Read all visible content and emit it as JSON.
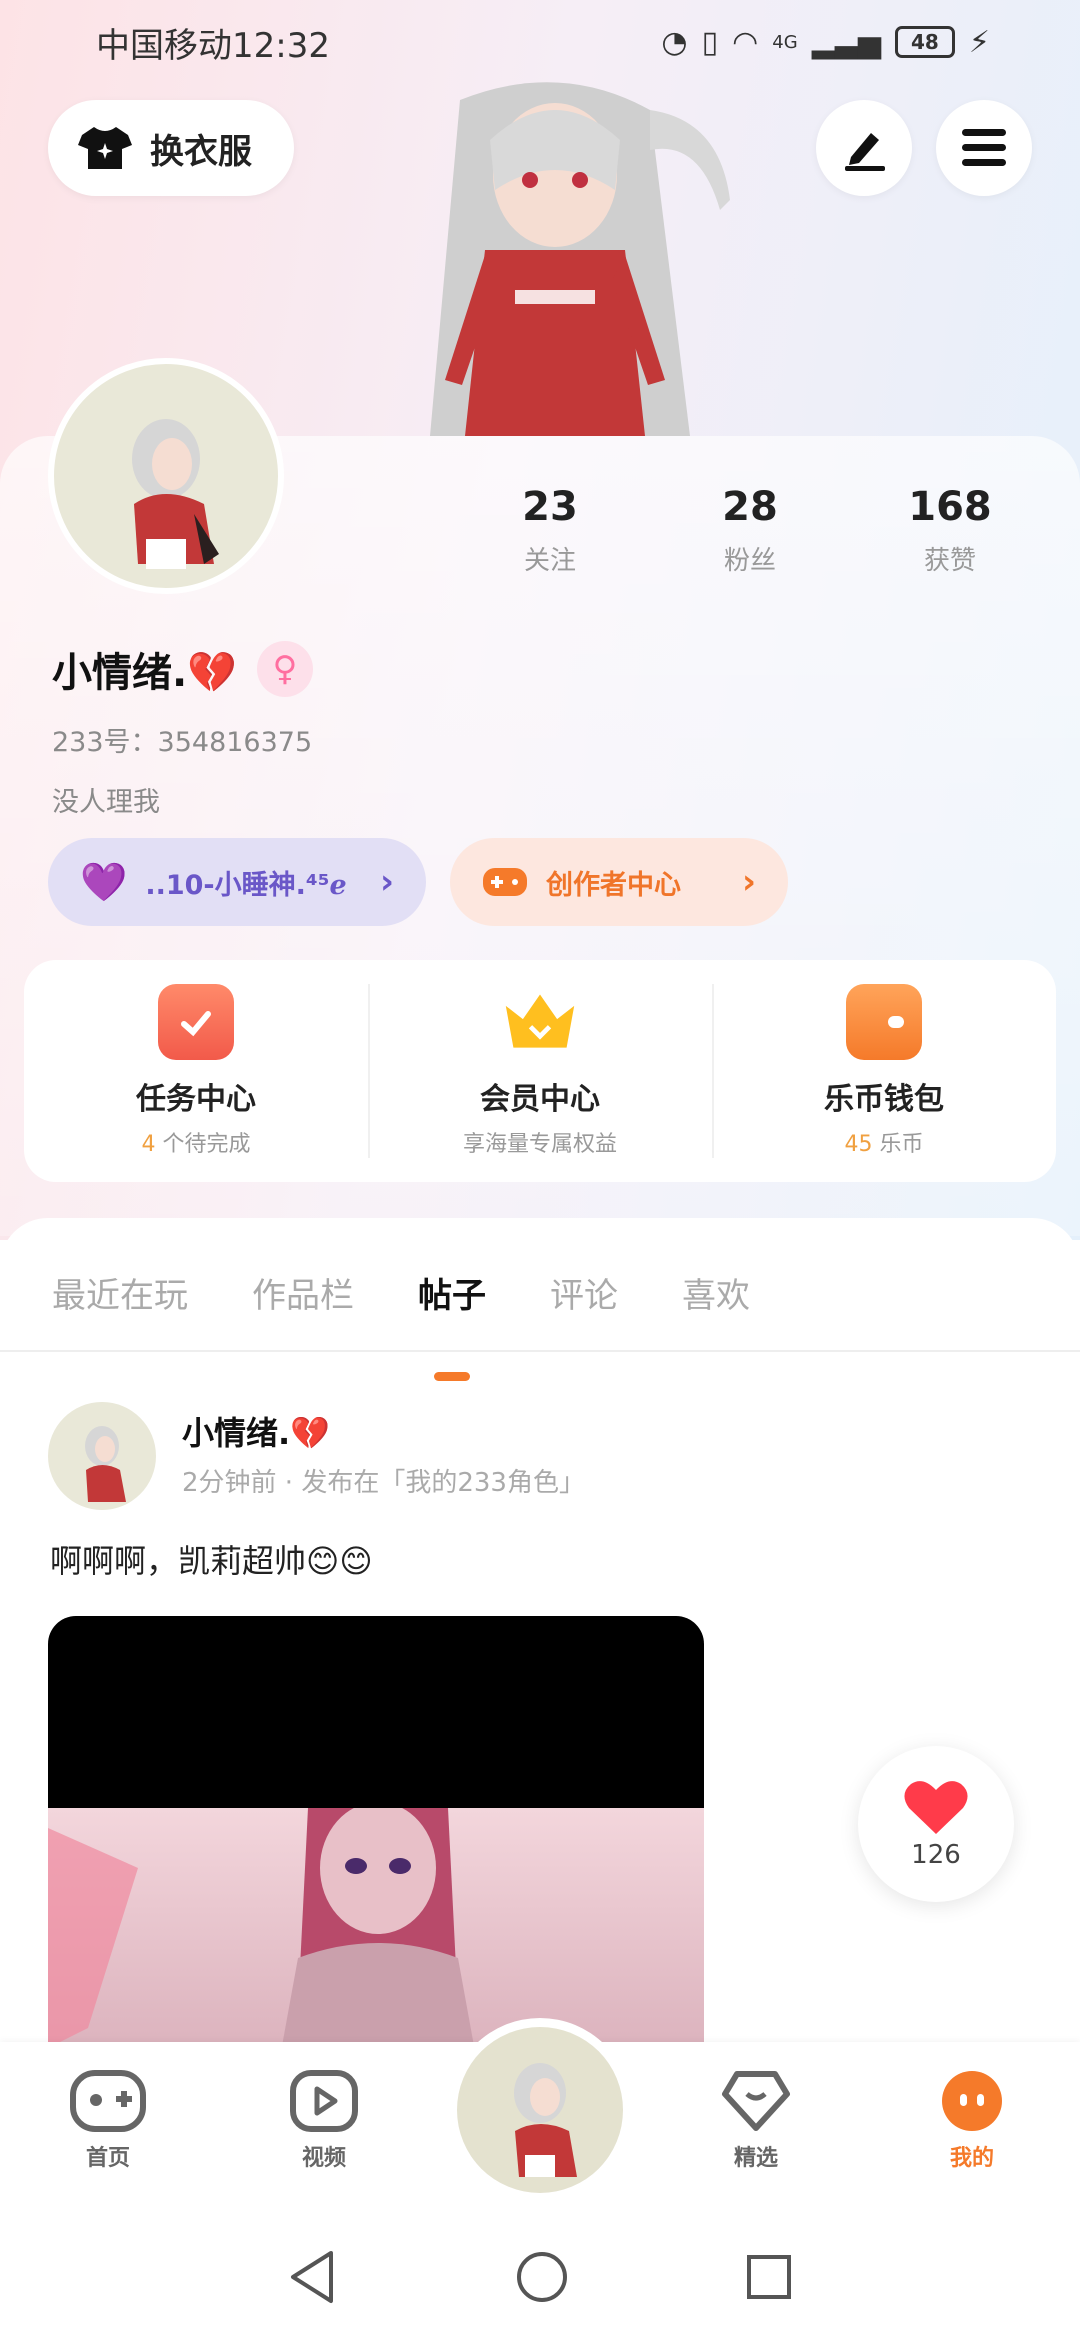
{
  "status_bar": {
    "carrier_time": "中国移动12:32",
    "network": "4G",
    "battery": "48"
  },
  "header": {
    "outfit_label": "换衣服",
    "edit_icon": "pencil-icon",
    "menu_icon": "menu-icon"
  },
  "profile": {
    "username": "小情绪.💔",
    "account_id": "233号：354816375",
    "bio": "没人理我",
    "stats": [
      {
        "value": "23",
        "label": "关注"
      },
      {
        "value": "28",
        "label": "粉丝"
      },
      {
        "value": "168",
        "label": "获赞"
      }
    ],
    "level_pill": "..10-小睡神.⁴⁵ℯ",
    "creator_pill": "创作者中心"
  },
  "features": [
    {
      "title": "任务中心",
      "sub_highlight": "4",
      "sub_text": " 个待完成"
    },
    {
      "title": "会员中心",
      "sub_highlight": "",
      "sub_text": "享海量专属权益"
    },
    {
      "title": "乐币钱包",
      "sub_highlight": "45",
      "sub_text": " 乐币"
    }
  ],
  "tabs": [
    "最近在玩",
    "作品栏",
    "帖子",
    "评论",
    "喜欢"
  ],
  "active_tab": "帖子",
  "post": {
    "author": "小情绪.💔",
    "meta": "2分钟前 · 发布在「我的233角色」",
    "text": "啊啊啊，凯莉超帅😊😊",
    "likes": "126"
  },
  "bottom_nav": [
    {
      "label": "首页",
      "icon": "gamepad-icon"
    },
    {
      "label": "视频",
      "icon": "play-icon"
    },
    {
      "label": "精选",
      "icon": "heart-diamond-icon"
    },
    {
      "label": "我的",
      "icon": "face-icon"
    }
  ],
  "colors": {
    "accent": "#f57a2a",
    "level_purple": "#6a57c8",
    "like_red": "#ff3b4a"
  }
}
